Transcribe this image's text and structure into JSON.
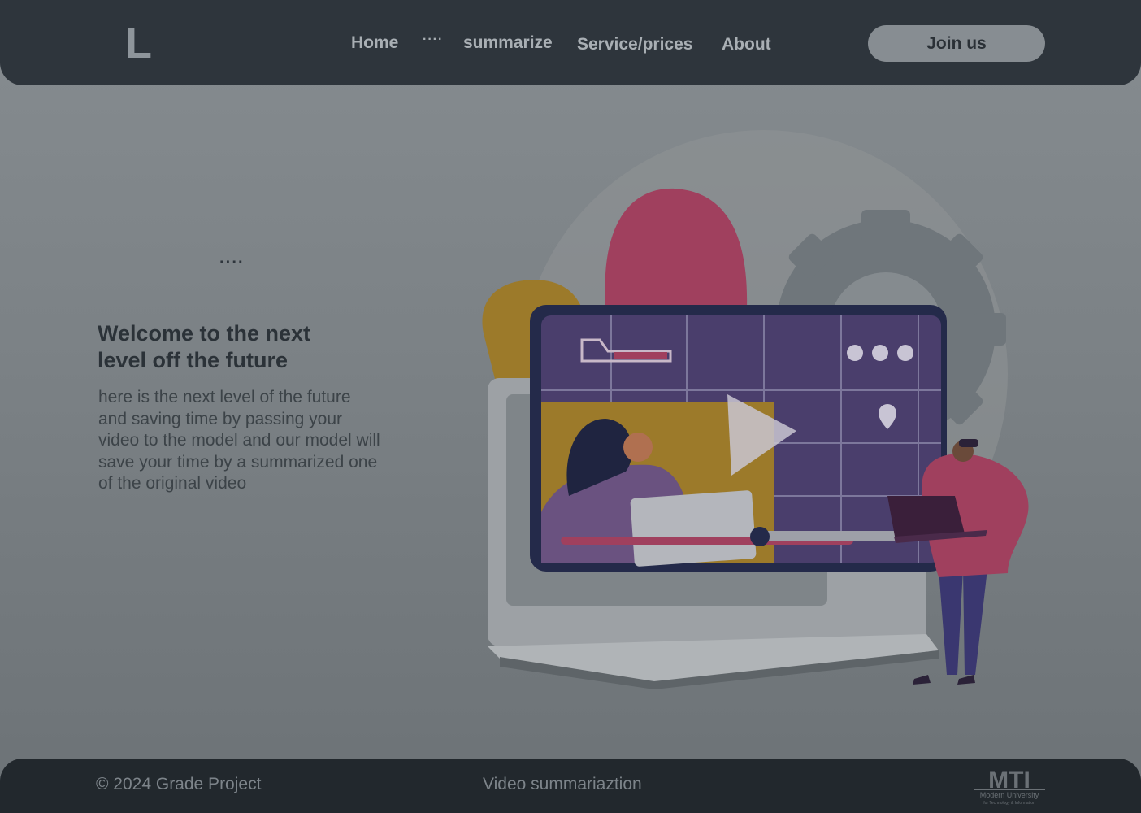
{
  "header": {
    "logo": "L",
    "nav": {
      "home": "Home",
      "more": "····",
      "summarize": "summarize",
      "service": "Service/prices",
      "about": "About"
    },
    "join_label": "Join us"
  },
  "hero": {
    "dots": "····",
    "title": "Welcome to the next level off the future",
    "description": "here is the next level of the future and saving time by passing your video to the model and our model will save your time by a summarized one of the original video"
  },
  "footer": {
    "copyright": "© 2024 Grade Project",
    "center_text": "Video summariaztion",
    "logo_text": "MTI",
    "logo_caption": "Modern University",
    "logo_subcaption": "for Technology & Information"
  },
  "colors": {
    "navbar": "#2e353c",
    "footer": "#22282d",
    "accent_pink": "#a0405e",
    "accent_yellow": "#9c7a2a",
    "screen_purple": "#4a3e6c"
  }
}
